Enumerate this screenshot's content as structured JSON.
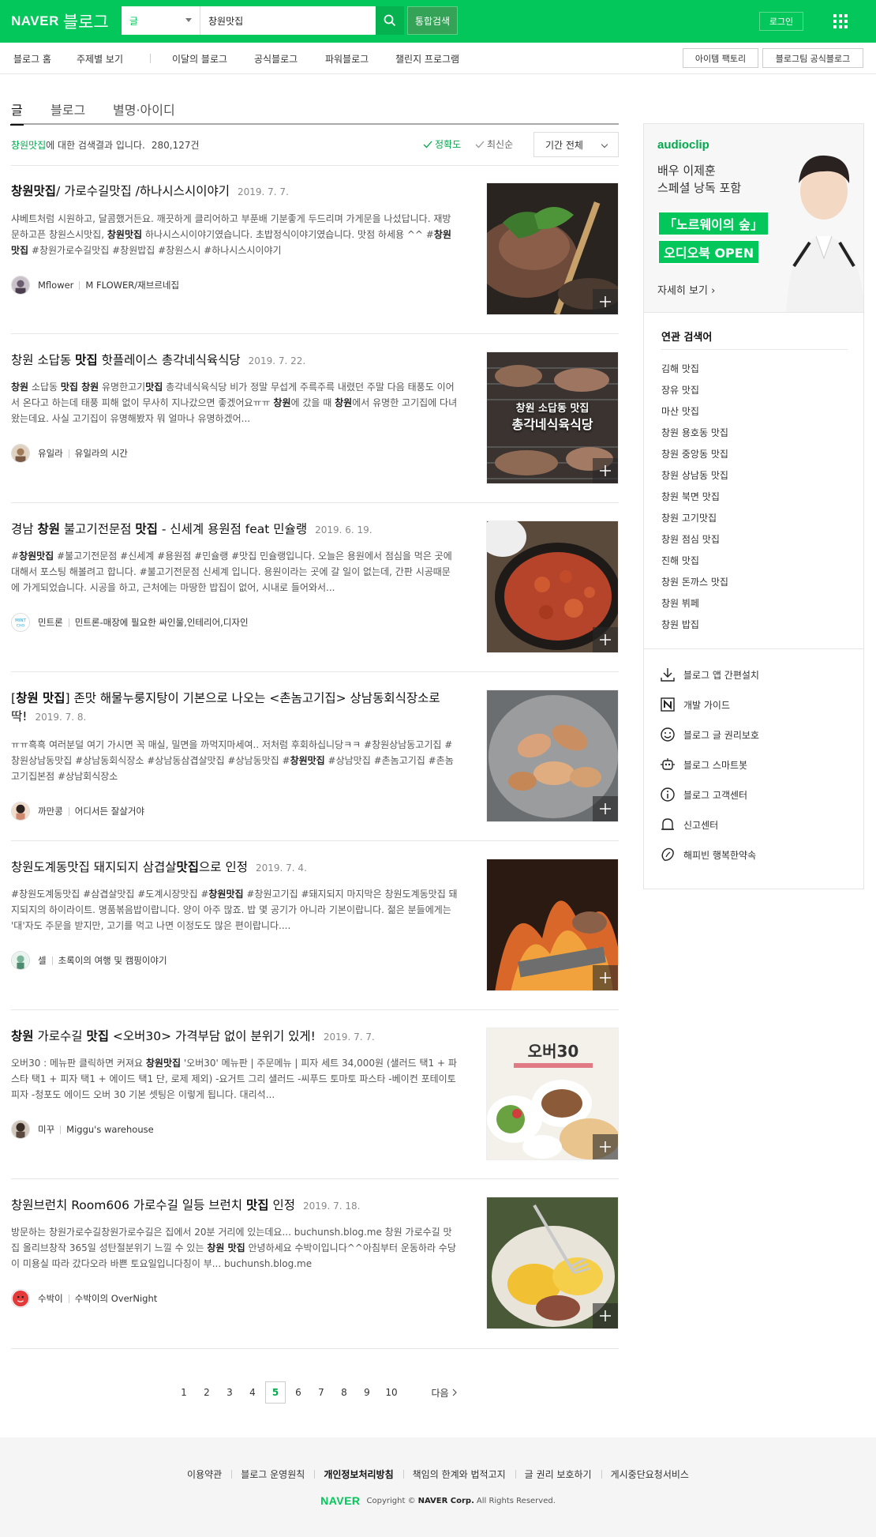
{
  "header": {
    "logo_naver": "NAVER",
    "logo_blog": "블로그",
    "search_type": "글",
    "search_value": "창원맛집",
    "total_search_label": "통합검색",
    "login_label": "로그인",
    "accent_color": "#03c75a"
  },
  "subnav": {
    "items": [
      "블로그 홈",
      "주제별 보기",
      "이달의 블로그",
      "공식블로그",
      "파워블로그",
      "챌린지 프로그램"
    ],
    "right_buttons": [
      "아이템 팩토리",
      "블로그팀 공식블로그"
    ]
  },
  "tabs": [
    "글",
    "블로그",
    "별명·아이디"
  ],
  "results_header": {
    "query": "창원맛집",
    "suffix": "에 대한 검색결과 입니다.",
    "count": "280,127건",
    "sort_accuracy": "정확도",
    "sort_recent": "최신순",
    "period": "기간 전체"
  },
  "results": [
    {
      "title_html": "<b>창원맛집</b>/ 가로수길맛집 /하나시스시이야기",
      "date": "2019. 7. 7.",
      "desc_html": "샤베트처럼 시원하고, 달콤했거든요. 깨끗하게 클리어하고 부푼배 기분좋게 두드리며 가게문을 나섰답니다. 재방문하고픈 창원스시맛집, <b>창원맛집</b> 하나시스시이야기였습니다. 초밥정식이야기였습니다. 맛점 하세용 ^^ #<b>창원맛집</b> #창원가로수길맛집 #창원밥집 #창원스시 #하나시스시이야기",
      "author": "Mflower",
      "blog": "M FLOWER/재브르네집"
    },
    {
      "title_html": "창원 소답동 <b>맛집</b> 핫플레이스 총각네식육식당",
      "date": "2019. 7. 22.",
      "desc_html": "<b>창원</b> 소답동 <b>맛집 창원</b> 유명한고기<b>맛집</b> 총각네식육식당 비가 정말 무섭게 주륵주륵 내렸던 주말 다음 태풍도 이어서 온다고 하는데 태풍 피해 없이 무사히 지나갔으면 좋겠어요ㅠㅠ <b>창원</b>에 갔을 때 <b>창원</b>에서 유명한 고기집에 다녀왔는데요. 사실 고기집이 유명해봤자 뭐 얼마나 유명하겠어...",
      "author": "유일라",
      "blog": "유일라의 시간",
      "thumb_text_1": "창원 소답동 맛집",
      "thumb_text_2": "총각네식육식당"
    },
    {
      "title_html": "경남 <b>창원</b> 불고기전문점 <b>맛집</b> - 신세계 용원점 feat 민슐랭",
      "date": "2019. 6. 19.",
      "desc_html": "#<b>창원맛집</b> #불고기전문점 #신세계 #용원점 #민슐랭 #맛집 민슐랭입니다. 오늘은 용원에서 점심을 먹은 곳에 대해서 포스팅 해볼려고 합니다. #불고기전문점 신세계 입니다. 용원이라는 곳에 갈 일이 없는데, 간판 시공때문에 가게되었습니다. 시공을 하고, 근처에는 마땅한 밥집이 없어, 시내로 들어와서...",
      "author": "민트론",
      "blog": "민트론-매장에 필요한 싸인물,인테리어,디자인"
    },
    {
      "title_html": "[<b>창원 맛집</b>] 존맛 해물누룽지탕이 기본으로 나오는 &lt;촌놈고기집&gt; 상남동회식장소로 딱!",
      "date": "2019. 7. 8.",
      "desc_html": "ㅠㅠ흑흑 여러분덜 여기 가시면 꼭 매실, 밀면을 까먹지마세여.. 저처럼 후회하십니당ㅋㅋ #창원상남동고기집 #창원상남동맛집 #상남동회식장소 #상남동삼겹살맛집 #상남동맛집 #<b>창원맛집</b> #상남맛집 #촌놈고기집 #촌놈고기집본점 #상남회식장소",
      "author": "까만콩",
      "blog": "어디서든 잘살거야"
    },
    {
      "title_html": "창원도계동맛집 돼지되지 삼겹살<b>맛집</b>으로 인정",
      "date": "2019. 7. 4.",
      "desc_html": "#창원도계동맛집 #삼겹살맛집 #도계시장맛집 #<b>창원맛집</b> #창원고기집 #돼지되지 마지막은 창원도계동맛집 돼지되지의 하이라이트. 명품볶음밥이랍니다. 양이 아주 많죠. 밥 몇 공기가 아니라 기본이랍니다. 젊은 분들에게는 '대'자도 주문을 받지만, 고기를 먹고 나면 이정도도 많은 편이랍니다....",
      "author": "셀",
      "blog": "초록이의 여행 및 캠핑이야기"
    },
    {
      "title_html": "<b>창원</b> 가로수길 <b>맛집</b> &lt;오버30&gt; 가격부담 없이 분위기 있게!",
      "date": "2019. 7. 7.",
      "desc_html": "오버30 : 메뉴판 클릭하면 커져요 <b>창원맛집</b> '오버30' 메뉴판 | 주문메뉴 | 피자 세트 34,000원 (샐러드 택1 + 파스타 택1 + 피자 택1 + 에이드 택1 단, 로제 제외) -요거트 그리 샐러드 -씨푸드 토마토 파스타 -베이컨 포테이토 피자 -청포도 에이드 오버 30 기본 셋팅은 이렇게 됩니다. 대리석...",
      "author": "미꾸",
      "blog": "Miggu's warehouse",
      "thumb_text_1": "오버30"
    },
    {
      "title_html": "창원브런치 Room606 가로수길 일등 브런치 <b>맛집</b> 인정",
      "date": "2019. 7. 18.",
      "desc_html": "방문하는 창원가로수길창원가로수길은 집에서 20분 거리에 있는데요... buchunsh.blog.me 창원 가로수길 맛집 올리브창작 365일 성탄절분위기 느낄 수 있는 <b>창원 맛집</b> 안녕하세요 수박이입니다^^아침부터 운동하라 수당이 미용실 따라 갔다오라 바쁜 토요일입니다칭이 부... buchunsh.blog.me",
      "author": "수박이",
      "blog": "수박이의 OverNight"
    }
  ],
  "pagination": {
    "pages": [
      "1",
      "2",
      "3",
      "4",
      "5",
      "6",
      "7",
      "8",
      "9",
      "10"
    ],
    "current": "5",
    "next_label": "다음"
  },
  "ad": {
    "brand": "audioclip",
    "line1": "배우 이제훈",
    "line2": "스페셜 낭독 포함",
    "box1": "「노르웨이의 숲」",
    "box2": "오디오북 OPEN",
    "more": "자세히 보기"
  },
  "related": {
    "title": "연관 검색어",
    "items": [
      "김해 맛집",
      "장유 맛집",
      "마산 맛집",
      "창원 용호동 맛집",
      "창원 중앙동 맛집",
      "창원 상남동 맛집",
      "창원 북면 맛집",
      "창원 고기맛집",
      "창원 점심 맛집",
      "진해 맛집",
      "창원 돈까스 맛집",
      "창원 뷔페",
      "창원 밥집"
    ]
  },
  "tools": [
    {
      "label": "블로그 앱 간편설치",
      "icon": "download-icon"
    },
    {
      "label": "개발 가이드",
      "icon": "n-logo-icon"
    },
    {
      "label": "블로그 글 권리보호",
      "icon": "smile-icon"
    },
    {
      "label": "블로그 스마트봇",
      "icon": "robot-icon"
    },
    {
      "label": "블로그 고객센터",
      "icon": "info-icon"
    },
    {
      "label": "신고센터",
      "icon": "bell-icon"
    },
    {
      "label": "해피빈 행복한약속",
      "icon": "bean-icon"
    }
  ],
  "footer": {
    "links": [
      "이용약관",
      "블로그 운영원칙",
      "개인정보처리방침",
      "책임의 한계와 법적고지",
      "글 권리 보호하기",
      "게시중단요청서비스"
    ],
    "logo": "NAVER",
    "copy_prefix": "Copyright ©",
    "copy_corp": "NAVER Corp.",
    "copy_suffix": "All Rights Reserved."
  }
}
